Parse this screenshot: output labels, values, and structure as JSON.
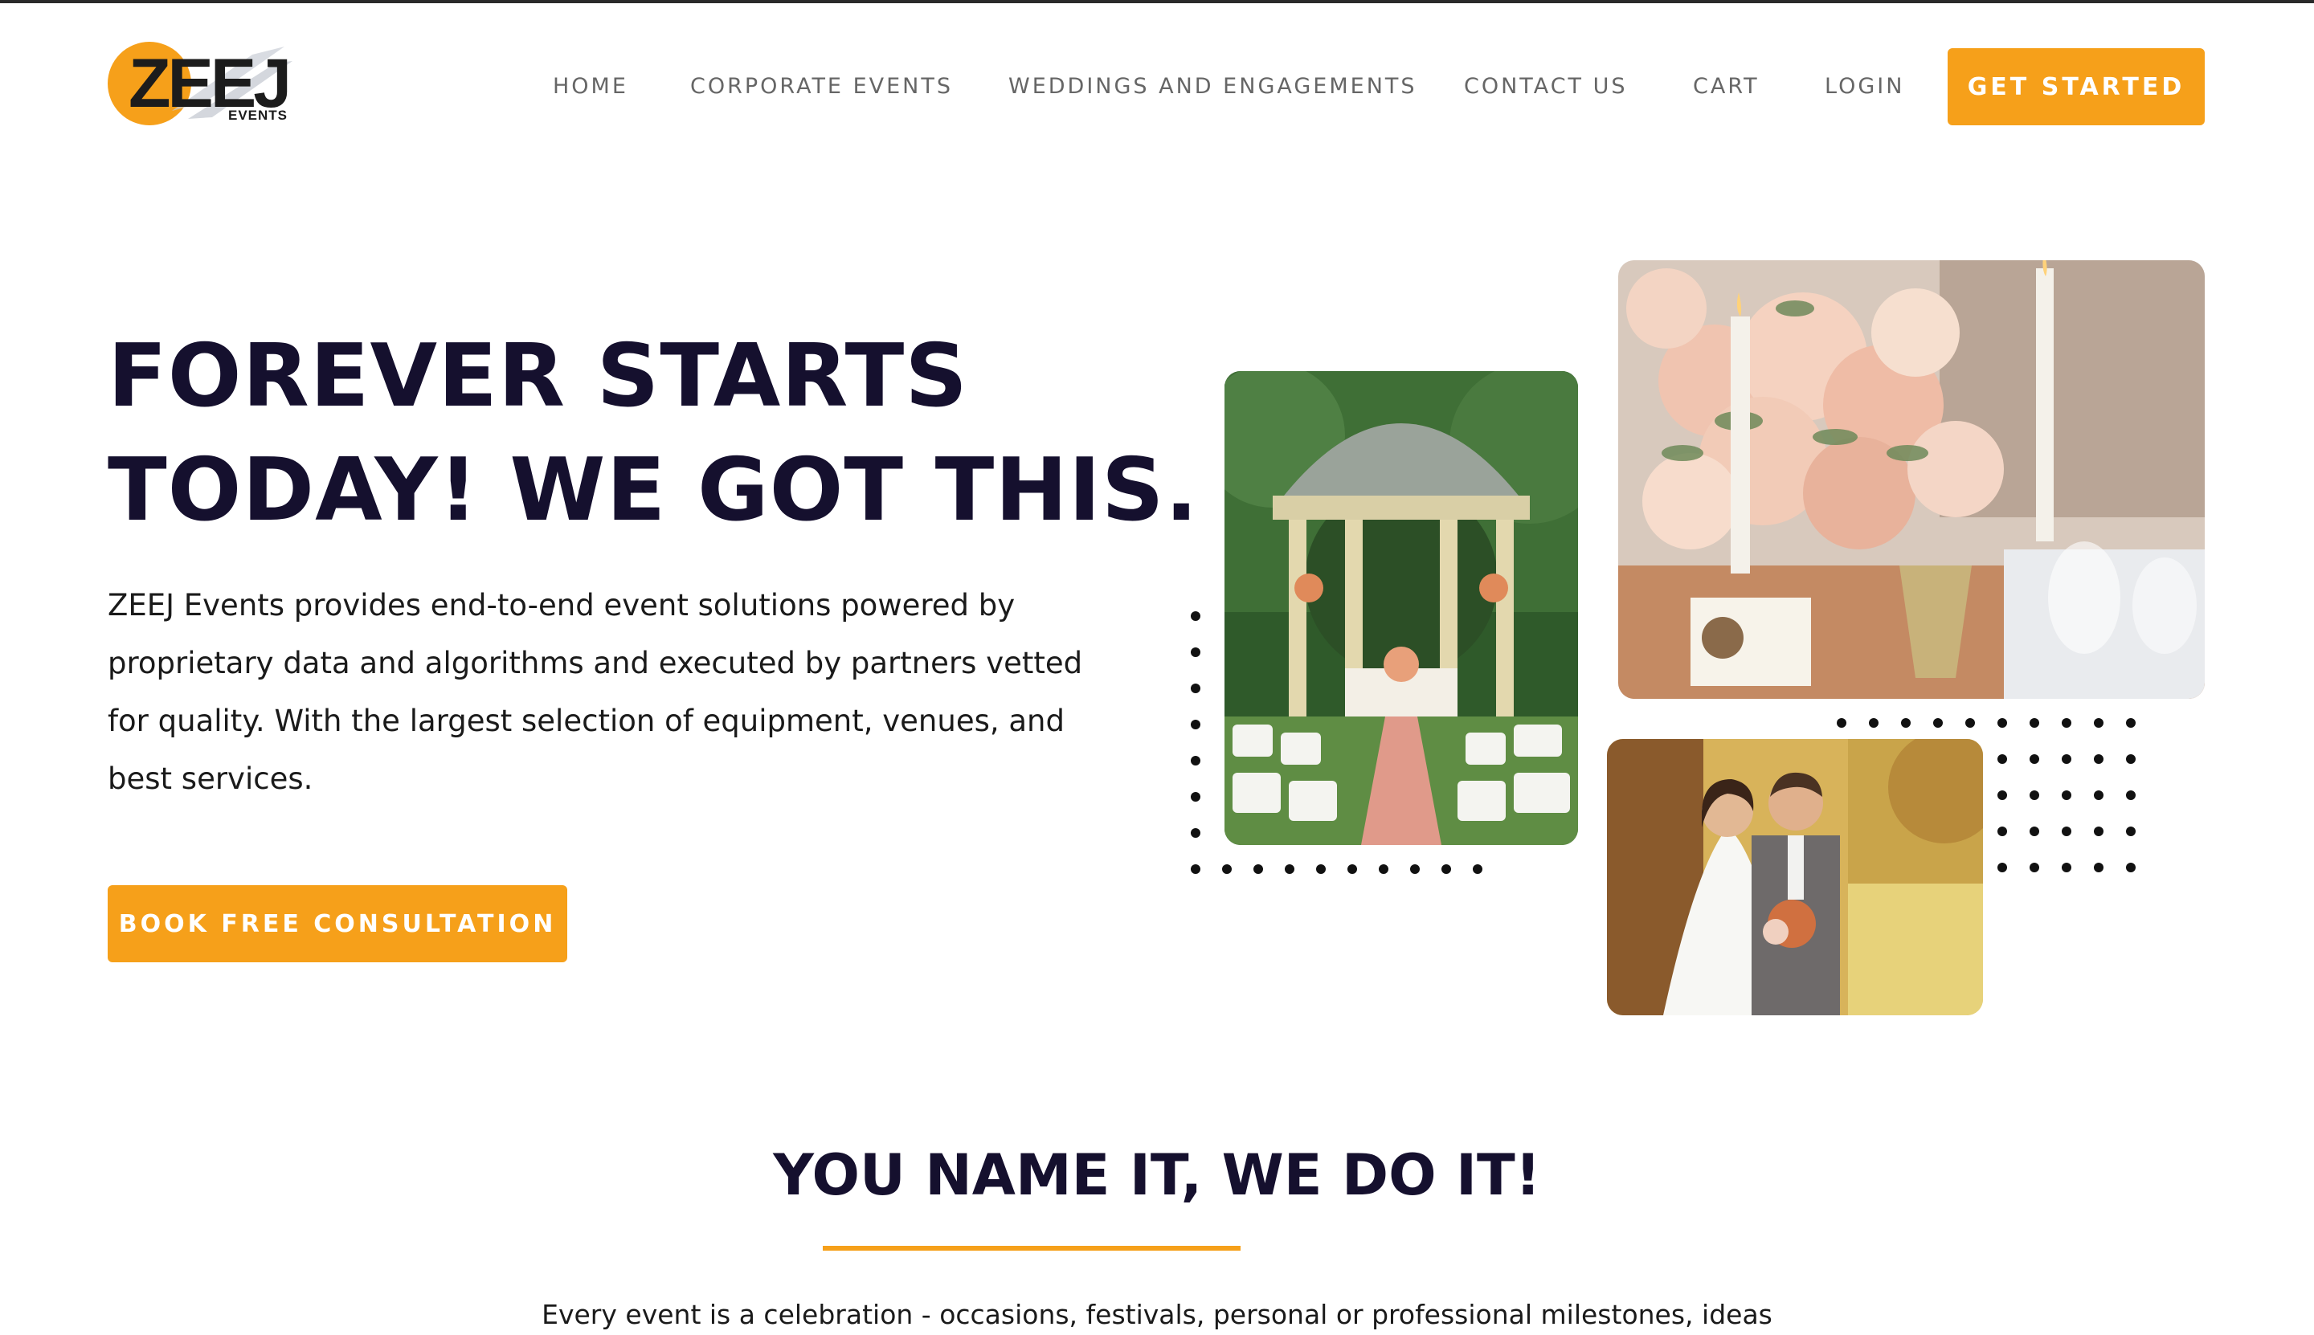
{
  "brand": {
    "logo_text": "ZEEJ",
    "logo_sub": "EVENTS",
    "accent": "#f6a01a",
    "heading_color": "#15102e"
  },
  "nav": {
    "items": [
      "HOME",
      "CORPORATE EVENTS",
      "WEDDINGS AND ENGAGEMENTS",
      "CONTACT US",
      "CART",
      "LOGIN"
    ],
    "cta": "GET STARTED"
  },
  "hero": {
    "title_line1": "FOREVER STARTS",
    "title_line2": "TODAY! WE GOT THIS.",
    "description": "ZEEJ Events provides end-to-end event solutions powered by proprietary data and algorithms and executed by partners vetted for quality. With the largest selection of equipment, venues, and best services.",
    "button": "BOOK FREE CONSULTATION"
  },
  "collage": {
    "images": [
      "gazebo-ceremony-photo",
      "floral-table-candles-photo",
      "wedding-couple-photo"
    ]
  },
  "section": {
    "title": "YOU NAME IT, WE DO IT!",
    "text": "Every event is a celebration - occasions, festivals, personal or professional milestones, ideas"
  }
}
